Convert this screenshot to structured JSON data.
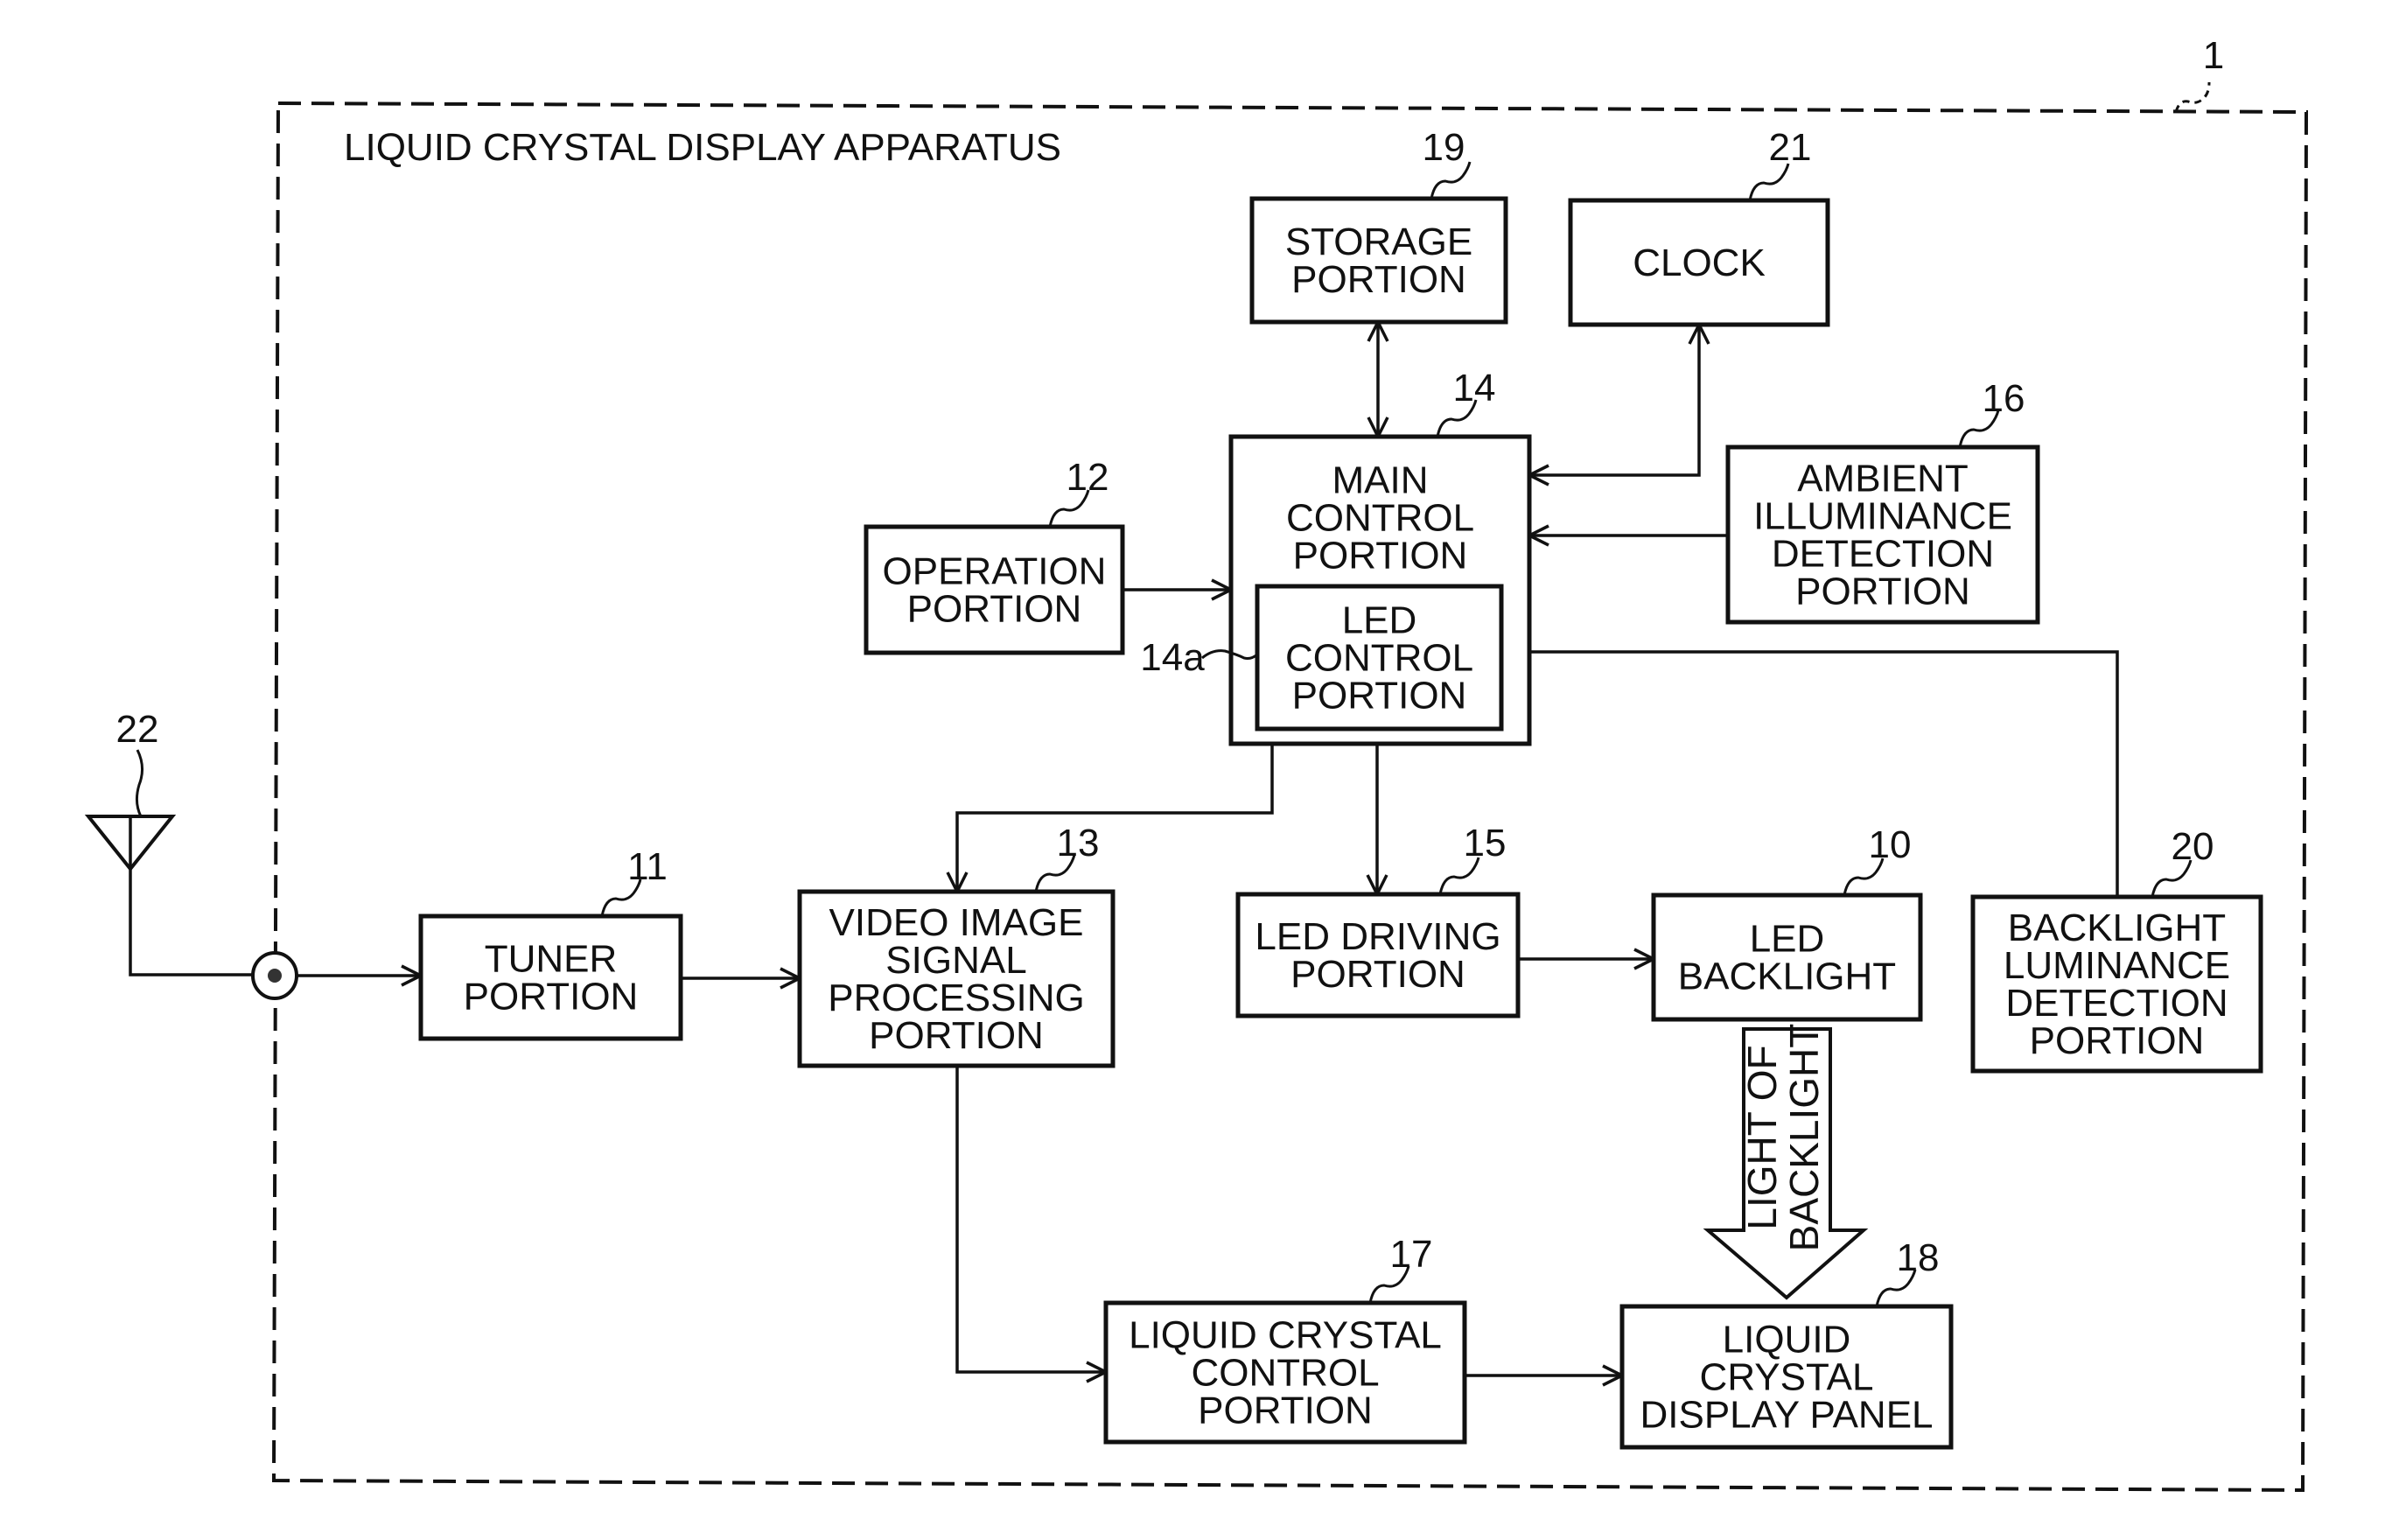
{
  "figure": {
    "title": "LIQUID CRYSTAL DISPLAY APPARATUS",
    "apparatus_ref": "1"
  },
  "blocks": {
    "tuner": {
      "ref": "11",
      "lines": [
        "TUNER",
        "PORTION"
      ]
    },
    "operation": {
      "ref": "12",
      "lines": [
        "OPERATION",
        "PORTION"
      ]
    },
    "video": {
      "ref": "13",
      "lines": [
        "VIDEO IMAGE",
        "SIGNAL",
        "PROCESSING",
        "PORTION"
      ]
    },
    "main_control": {
      "ref": "14",
      "lines": [
        "MAIN",
        "CONTROL",
        "PORTION"
      ]
    },
    "led_control": {
      "ref": "14a",
      "lines": [
        "LED",
        "CONTROL",
        "PORTION"
      ]
    },
    "led_driving": {
      "ref": "15",
      "lines": [
        "LED DRIVING",
        "PORTION"
      ]
    },
    "ambient": {
      "ref": "16",
      "lines": [
        "AMBIENT",
        "ILLUMINANCE",
        "DETECTION",
        "PORTION"
      ]
    },
    "lc_control": {
      "ref": "17",
      "lines": [
        "LIQUID CRYSTAL",
        "CONTROL",
        "PORTION"
      ]
    },
    "lc_panel": {
      "ref": "18",
      "lines": [
        "LIQUID",
        "CRYSTAL",
        "DISPLAY PANEL"
      ]
    },
    "storage": {
      "ref": "19",
      "lines": [
        "STORAGE",
        "PORTION"
      ]
    },
    "bl_luminance": {
      "ref": "20",
      "lines": [
        "BACKLIGHT",
        "LUMINANCE",
        "DETECTION",
        "PORTION"
      ]
    },
    "clock": {
      "ref": "21",
      "lines": [
        "CLOCK"
      ]
    },
    "led_backlight": {
      "ref": "10",
      "lines": [
        "LED",
        "BACKLIGHT"
      ]
    }
  },
  "antenna": {
    "ref": "22",
    "icon": "antenna-icon"
  },
  "connector": {
    "icon": "input-terminal-icon"
  },
  "light_arrow": {
    "lines": [
      "LIGHT OF",
      "BACKLIGHT"
    ]
  },
  "connections": [
    {
      "from": "antenna",
      "to": "tuner"
    },
    {
      "from": "tuner",
      "to": "video"
    },
    {
      "from": "operation",
      "to": "main_control"
    },
    {
      "from": "storage",
      "to": "main_control",
      "bidirectional": true
    },
    {
      "from": "main_control",
      "to": "clock",
      "bidirectional": true
    },
    {
      "from": "ambient",
      "to": "main_control"
    },
    {
      "from": "bl_luminance",
      "to": "led_control"
    },
    {
      "from": "main_control",
      "to": "video"
    },
    {
      "from": "main_control",
      "to": "led_driving"
    },
    {
      "from": "led_driving",
      "to": "led_backlight"
    },
    {
      "from": "video",
      "to": "lc_control"
    },
    {
      "from": "lc_control",
      "to": "lc_panel"
    },
    {
      "from": "led_backlight",
      "to": "lc_panel",
      "label": "light_arrow"
    }
  ]
}
